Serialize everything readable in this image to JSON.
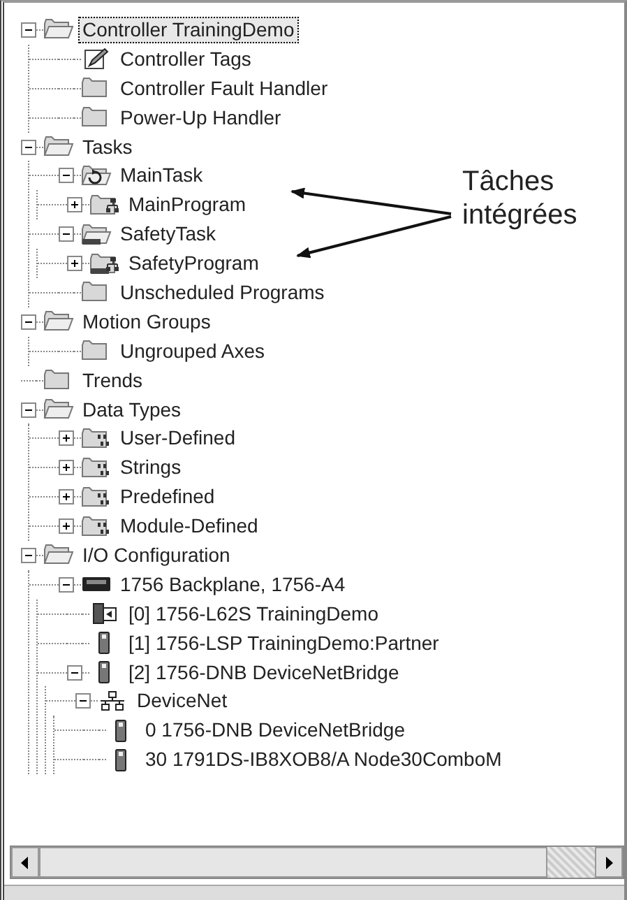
{
  "tree": [
    {
      "label": "Controller TrainingDemo",
      "kind": "folder",
      "expanded": true,
      "selected": true,
      "children": [
        {
          "label": "Controller Tags",
          "kind": "tags",
          "selected": false
        },
        {
          "label": "Controller Fault Handler",
          "kind": "folder",
          "selected": false
        },
        {
          "label": "Power-Up Handler",
          "kind": "folder",
          "selected": false
        }
      ]
    },
    {
      "label": "Tasks",
      "kind": "folder",
      "expanded": true,
      "selected": false,
      "children": [
        {
          "label": "MainTask",
          "kind": "task",
          "expanded": true,
          "selected": false,
          "children": [
            {
              "label": "MainProgram",
              "kind": "program",
              "expanded": false,
              "selected": false
            }
          ]
        },
        {
          "label": "SafetyTask",
          "kind": "safety-task",
          "expanded": true,
          "selected": false,
          "children": [
            {
              "label": "SafetyProgram",
              "kind": "safety-program",
              "expanded": false,
              "selected": false
            }
          ]
        },
        {
          "label": "Unscheduled Programs",
          "kind": "folder",
          "selected": false
        }
      ]
    },
    {
      "label": "Motion Groups",
      "kind": "folder",
      "expanded": true,
      "selected": false,
      "children": [
        {
          "label": "Ungrouped Axes",
          "kind": "folder",
          "selected": false
        }
      ]
    },
    {
      "label": "Trends",
      "kind": "folder",
      "selected": false
    },
    {
      "label": "Data Types",
      "kind": "folder",
      "expanded": true,
      "selected": false,
      "children": [
        {
          "label": "User-Defined",
          "kind": "data-type",
          "expanded": false,
          "selected": false
        },
        {
          "label": "Strings",
          "kind": "data-type",
          "expanded": false,
          "selected": false
        },
        {
          "label": "Predefined",
          "kind": "data-type",
          "expanded": false,
          "selected": false
        },
        {
          "label": "Module-Defined",
          "kind": "data-type",
          "expanded": false,
          "selected": false
        }
      ]
    },
    {
      "label": "I/O Configuration",
      "kind": "folder",
      "expanded": true,
      "selected": false,
      "children": [
        {
          "label": "1756 Backplane, 1756-A4",
          "kind": "backplane",
          "expanded": true,
          "selected": false,
          "children": [
            {
              "label": "[0] 1756-L62S TrainingDemo",
              "kind": "controller",
              "selected": false
            },
            {
              "label": "[1] 1756-LSP TrainingDemo:Partner",
              "kind": "module",
              "selected": false
            },
            {
              "label": "[2] 1756-DNB DeviceNetBridge",
              "kind": "module",
              "expanded": true,
              "selected": false,
              "children": [
                {
                  "label": "DeviceNet",
                  "kind": "network",
                  "expanded": true,
                  "selected": false,
                  "children": [
                    {
                      "label": "0 1756-DNB DeviceNetBridge",
                      "kind": "module",
                      "selected": false
                    },
                    {
                      "label": "30 1791DS-IB8XOB8/A Node30ComboM",
                      "kind": "module",
                      "selected": false
                    }
                  ]
                }
              ]
            }
          ]
        }
      ]
    }
  ],
  "callout": {
    "text": "Tâches intégrées"
  }
}
